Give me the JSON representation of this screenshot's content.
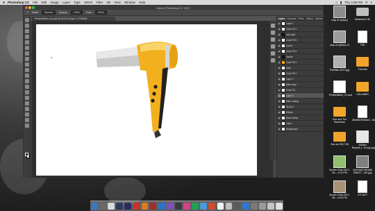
{
  "menubar": {
    "app": "Photoshop CC",
    "items": [
      "File",
      "Edit",
      "Image",
      "Layer",
      "Type",
      "Select",
      "Filter",
      "3D",
      "View",
      "Window",
      "Help"
    ],
    "time": "Thu 3:38 PM"
  },
  "window": {
    "title": "Adobe Photoshop CC 2017"
  },
  "options_bar": {
    "mode_label": "Mode:",
    "mode_value": "Normal",
    "opacity_label": "Opacity:",
    "opacity_value": "100%",
    "flow_label": "Flow:",
    "flow_value": "100%"
  },
  "document": {
    "tab": "Presentation_01.psd @ 33.3% (Layer 1, RGB/8) *"
  },
  "panels": {
    "tabs": [
      "Layers",
      "Channels",
      "Paths",
      "History",
      "Actions"
    ],
    "layers": [
      {
        "name": "Layer 1",
        "thumb": "white"
      },
      {
        "name": "Color Fill 1",
        "thumb": "white"
      },
      {
        "name": "hair dryer",
        "thumb": "dark"
      },
      {
        "name": "Color Fill 5",
        "thumb": "white"
      },
      {
        "name": "nozzle",
        "thumb": "white"
      },
      {
        "name": "Color Fill 4",
        "thumb": "white"
      },
      {
        "name": "handle",
        "thumb": "dark"
      },
      {
        "name": "Color Fill 3",
        "thumb": "yellow"
      },
      {
        "name": "body",
        "thumb": "white"
      },
      {
        "name": "Color Fill 2",
        "thumb": "white"
      },
      {
        "name": "Layer 2",
        "thumb": "white"
      },
      {
        "name": "Main body",
        "thumb": "white"
      },
      {
        "name": "Color Fill",
        "thumb": "white"
      },
      {
        "name": "Layer 3",
        "thumb": "white"
      },
      {
        "name": "Main Casing",
        "thumb": "white"
      },
      {
        "name": "Group 1",
        "thumb": "white"
      },
      {
        "name": "Effects",
        "thumb": "white"
      },
      {
        "name": "Base casing",
        "thumb": "white"
      },
      {
        "name": "Layer",
        "thumb": "white"
      },
      {
        "name": "Background",
        "thumb": "white"
      }
    ]
  },
  "desktop_icons": [
    {
      "label": "map of sydney",
      "kind": "img",
      "color": "#8c8c8c"
    },
    {
      "label": "Macintosh HD",
      "kind": "hd"
    },
    {
      "label": "map of sydney v2",
      "kind": "img",
      "color": "#9c9c9c"
    },
    {
      "label": "TZE",
      "kind": "doc"
    },
    {
      "label": "Portfolio 2017.jpg",
      "kind": "img",
      "color": "#b0b0b0"
    },
    {
      "label": "TUDelta",
      "kind": "folder"
    },
    {
      "label": "Presentation_01.psd",
      "kind": "img",
      "color": "#ffffff"
    },
    {
      "label": "VOLUMES",
      "kind": "folder"
    },
    {
      "label": "Soe and Tim Robertson",
      "kind": "folder"
    },
    {
      "label": "38e66d7b5d4c0...8d3d.jpg",
      "kind": "doc"
    },
    {
      "label": "Soe art 2017.08",
      "kind": "folder"
    },
    {
      "label": "1000px Bicycle_f...lt.svg.png",
      "kind": "img",
      "color": "#e6e6e6"
    },
    {
      "label": "Screen Shot 2017-06-...4.03 PM",
      "kind": "img",
      "color": "#8fbf6f"
    },
    {
      "label": "1047d4b71ff10b6 298227...281.jpg",
      "kind": "img",
      "color": "#7f7f7f"
    },
    {
      "label": "Screen Shot 2017-06-...5.26 PM",
      "kind": "img",
      "color": "#a89276"
    },
    {
      "label": "CV 2017",
      "kind": "doc"
    }
  ],
  "dock_apps": [
    "#3b78c4",
    "#6a6a6a",
    "#d9d9d9",
    "#2f3a5a",
    "#2b2b5f",
    "#c9322b",
    "#e07a1b",
    "#9c2f2f",
    "#2b73c4",
    "#7f4fbf",
    "#3a3a3a",
    "#d83f8c",
    "#1ea14f",
    "#4a9ad9",
    "#d04b2a",
    "#f2f2f2",
    "#bfbfbf",
    "#5a5a5a",
    "#2e78d3",
    "#7a7a7a",
    "#999999",
    "#c4c4c4",
    "#e0e0e0"
  ]
}
